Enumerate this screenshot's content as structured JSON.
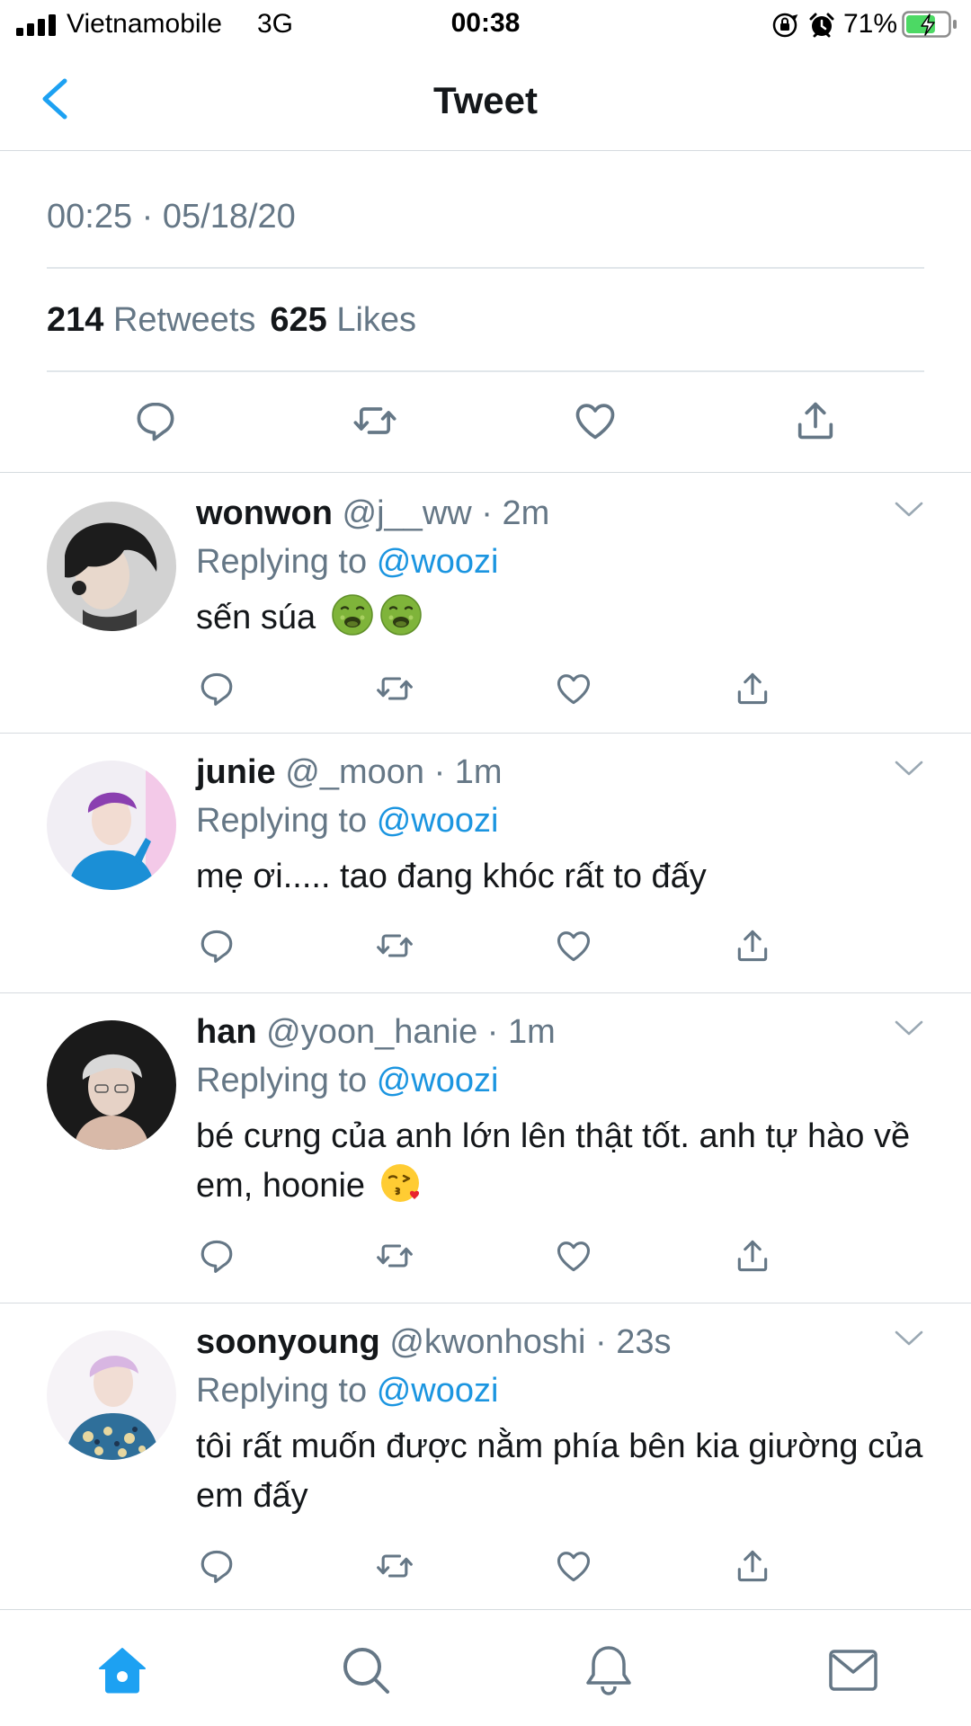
{
  "status_bar": {
    "carrier": "Vietnamobile",
    "network": "3G",
    "time": "00:38",
    "battery": "71%",
    "battery_level": 0.71
  },
  "nav": {
    "title": "Tweet"
  },
  "tweet": {
    "timestamp": "00:25 · 05/18/20",
    "retweets_count": "214",
    "retweets_label": "Retweets",
    "likes_count": "625",
    "likes_label": "Likes"
  },
  "replies": [
    {
      "name": "wonwon",
      "handle": "@j__ww",
      "time": "2m",
      "replying_prefix": "Replying to",
      "replying_to": "@woozi",
      "text": "sến súa",
      "emoji": [
        "nauseated-face-emoji",
        "nauseated-face-emoji"
      ]
    },
    {
      "name": "junie",
      "handle": "@_moon",
      "time": "1m",
      "replying_prefix": "Replying to",
      "replying_to": "@woozi",
      "text": "mẹ ơi..... tao đang khóc rất to đấy",
      "emoji": []
    },
    {
      "name": "han",
      "handle": "@yoon_hanie",
      "time": "1m",
      "replying_prefix": "Replying to",
      "replying_to": "@woozi",
      "text": "bé cưng của anh lớn lên thật tốt. anh tự hào về em, hoonie",
      "emoji": [
        "face-blowing-kiss-emoji"
      ]
    },
    {
      "name": "soonyoung",
      "handle": "@kwonhoshi",
      "time": "23s",
      "replying_prefix": "Replying to",
      "replying_to": "@woozi",
      "text": "tôi rất muốn được nằm phía bên kia giường của em đấy",
      "emoji": []
    }
  ],
  "tabbar": {
    "tabs": [
      "home-icon",
      "search-icon",
      "notifications-icon",
      "messages-icon"
    ],
    "active": "home-icon"
  },
  "colors": {
    "accent": "#1da1f2",
    "mention": "#1b95e0",
    "secondary_text": "#657786",
    "primary_text": "#14171a",
    "battery_fill": "#4cd964"
  }
}
